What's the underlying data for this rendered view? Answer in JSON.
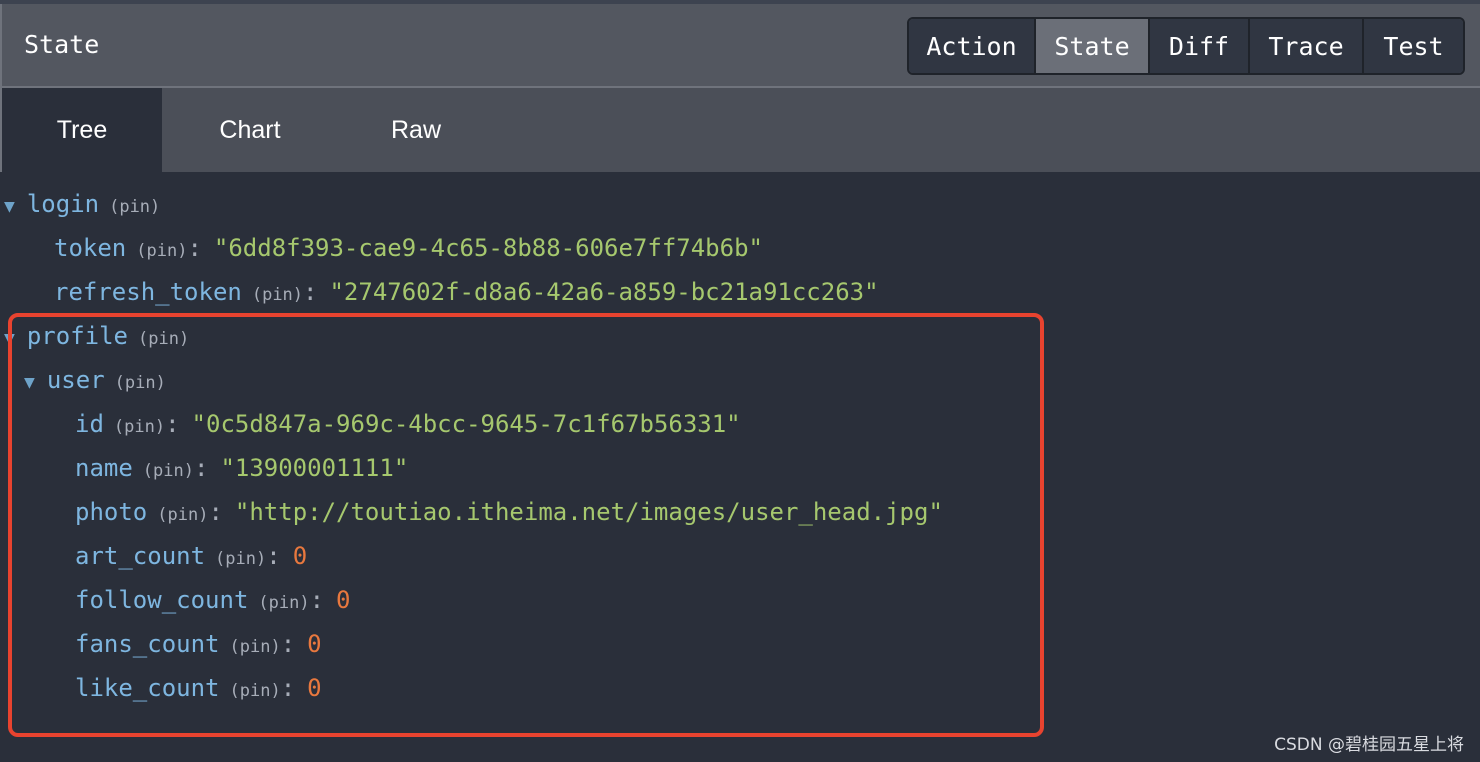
{
  "header": {
    "title": "State",
    "buttons": [
      "Action",
      "State",
      "Diff",
      "Trace",
      "Test"
    ],
    "active_button": "State"
  },
  "tabs": {
    "items": [
      "Tree",
      "Chart",
      "Raw"
    ],
    "active": "Tree"
  },
  "tree": {
    "pin_label": "(pin)",
    "login": {
      "key": "login",
      "token": {
        "key": "token",
        "value": "\"6dd8f393-cae9-4c65-8b88-606e7ff74b6b\""
      },
      "refresh_token": {
        "key": "refresh_token",
        "value": "\"2747602f-d8a6-42a6-a859-bc21a91cc263\""
      }
    },
    "profile": {
      "key": "profile",
      "user": {
        "key": "user",
        "id": {
          "key": "id",
          "value": "\"0c5d847a-969c-4bcc-9645-7c1f67b56331\""
        },
        "name": {
          "key": "name",
          "value": "\"13900001111\""
        },
        "photo": {
          "key": "photo",
          "value": "\"http://toutiao.itheima.net/images/user_head.jpg\""
        },
        "art_count": {
          "key": "art_count",
          "value": "0"
        },
        "follow_count": {
          "key": "follow_count",
          "value": "0"
        },
        "fans_count": {
          "key": "fans_count",
          "value": "0"
        },
        "like_count": {
          "key": "like_count",
          "value": "0"
        }
      }
    }
  },
  "colors": {
    "key": "#7eb6e0",
    "string": "#a6c86e",
    "number": "#e8783e",
    "highlight": "#e8432f"
  },
  "watermark": "CSDN @碧桂园五星上将"
}
